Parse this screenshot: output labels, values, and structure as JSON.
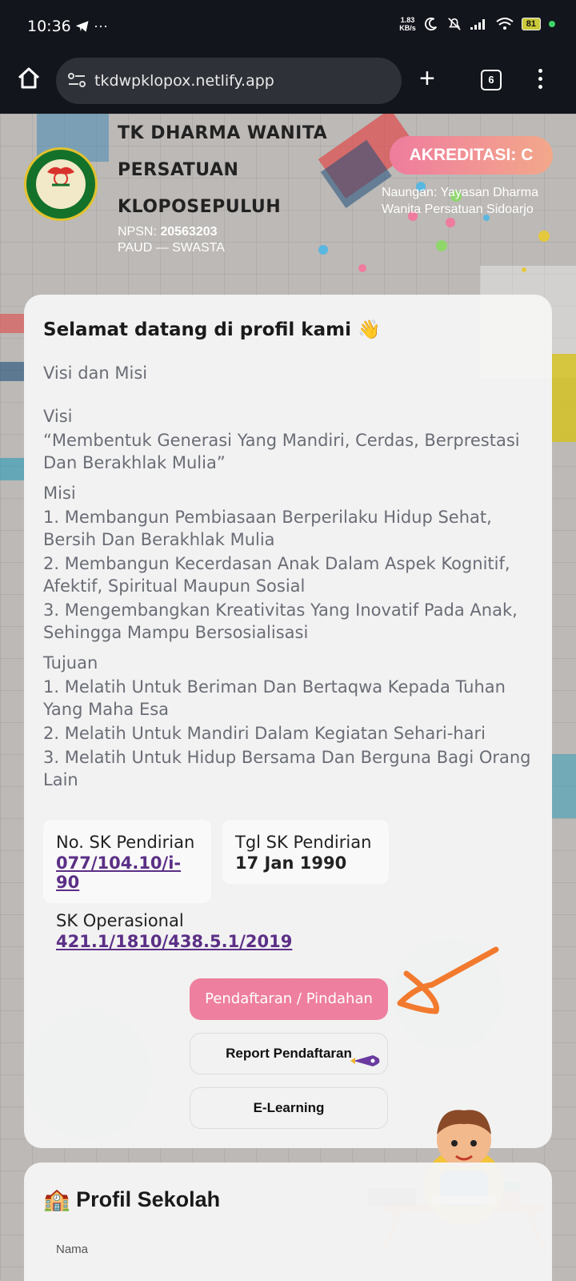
{
  "status_bar": {
    "time": "10:36",
    "left_icons": "telegram-icon",
    "more_dots": "···",
    "speed_value": "1.83",
    "speed_unit": "KB/s",
    "battery": "81"
  },
  "browser": {
    "url": "tkdwpklopox.netlify.app",
    "tab_count": "6"
  },
  "header": {
    "school_name_line1": "TK DHARMA WANITA",
    "school_name_line2": "PERSATUAN",
    "school_name_line3": "KLOPOSEPULUH",
    "npsn_label": "NPSN:",
    "npsn_value": "20563203",
    "type": "PAUD — SWASTA",
    "akreditasi": "AKREDITASI: C",
    "naungan": "Naungan: Yayasan Dharma Wanita Persatuan Sidoarjo"
  },
  "card": {
    "title": "Selamat datang di profil kami 👋",
    "section": "Visi dan Misi",
    "visi_label": "Visi",
    "visi_text": "“Membentuk Generasi Yang Mandiri, Cerdas, Berprestasi Dan Berakhlak Mulia”",
    "misi_label": "Misi",
    "misi": [
      "1. Membangun Pembiasaan Berperilaku Hidup Sehat, Bersih Dan Berakhlak Mulia",
      "2. Membangun Kecerdasan Anak Dalam Aspek Kognitif, Afektif, Spiritual Maupun Sosial",
      "3. Mengembangkan Kreativitas Yang Inovatif Pada Anak, Sehingga Mampu Bersosialisasi"
    ],
    "tujuan_label": "Tujuan",
    "tujuan": [
      "1. Melatih Untuk Beriman Dan Bertaqwa Kepada Tuhan Yang Maha Esa",
      "2. Melatih Untuk Mandiri Dalam Kegiatan Sehari-hari",
      "3. Melatih Untuk Hidup Bersama Dan Berguna Bagi Orang Lain"
    ],
    "sk_pendirian_label": "No. SK Pendirian",
    "sk_pendirian_value": "077/104.10/i-90",
    "tgl_sk_label": "Tgl SK Pendirian",
    "tgl_sk_value": "17 Jan 1990",
    "sk_operasional_label": "SK Operasional",
    "sk_operasional_value": "421.1/1810/438.5.1/2019",
    "btn_pendaftaran": "Pendaftaran / Pindahan",
    "btn_report": "Report Pendaftaran",
    "btn_elearning": "E-Learning"
  },
  "profile_card": {
    "title": "🏫 Profil Sekolah",
    "field_label": "Nama"
  },
  "colors": {
    "accent_pink": "#ee7f9e",
    "link_purple": "#5b2f86",
    "annotation_orange": "#f27a2e"
  }
}
